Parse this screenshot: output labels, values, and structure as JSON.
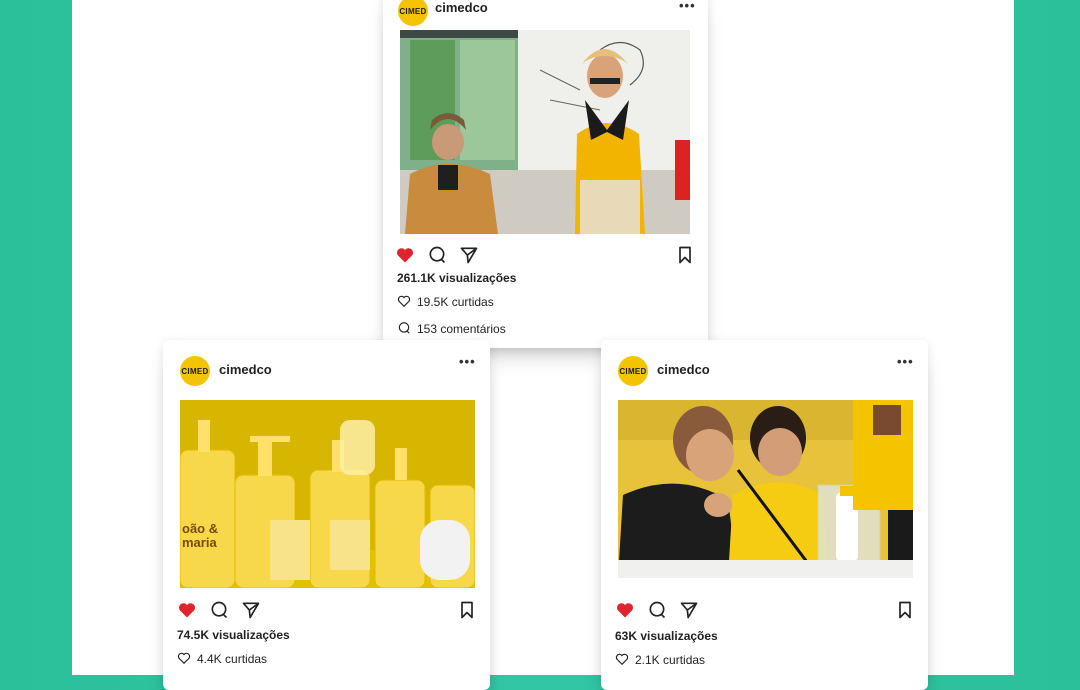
{
  "cards": [
    {
      "username": "cimedco",
      "avatar_text": "CIMED",
      "more_label": "•••",
      "views": "261.1K visualizações",
      "likes": "19.5K curtidas",
      "comments": "153 comentários"
    },
    {
      "username": "cimedco",
      "avatar_text": "CIMED",
      "more_label": "•••",
      "views": "74.5K visualizações",
      "likes": "4.4K curtidas",
      "bottle_label": "oão & maria"
    },
    {
      "username": "cimedco",
      "avatar_text": "CIMED",
      "more_label": "•••",
      "views": "63K visualizações",
      "likes": "2.1K curtidas"
    }
  ],
  "colors": {
    "background": "#2bbf9a",
    "brand_yellow": "#f5c400",
    "heart_red": "#e0242b"
  },
  "icons": [
    "heart-icon",
    "comment-icon",
    "share-icon",
    "bookmark-icon",
    "more-icon"
  ]
}
